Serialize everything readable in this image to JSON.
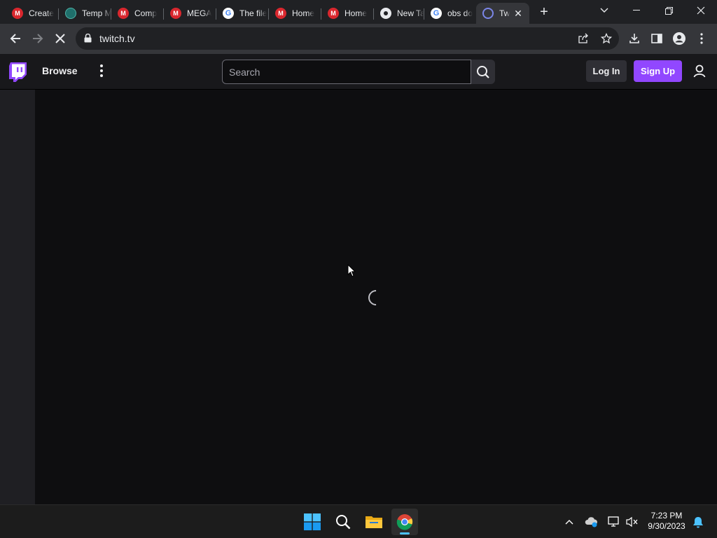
{
  "browser": {
    "tabs": [
      {
        "title": "Create",
        "favicon": "mega-icon"
      },
      {
        "title": "Temp M",
        "favicon": "temp-icon"
      },
      {
        "title": "Comp",
        "favicon": "mega-icon"
      },
      {
        "title": "MEGA",
        "favicon": "mega-icon"
      },
      {
        "title": "The file",
        "favicon": "google-icon"
      },
      {
        "title": "Home",
        "favicon": "mega-icon"
      },
      {
        "title": "Home",
        "favicon": "mega-icon"
      },
      {
        "title": "New Ta",
        "favicon": "chrome-icon"
      },
      {
        "title": "obs do",
        "favicon": "google-icon"
      },
      {
        "title": "Tw",
        "favicon": "loading-icon",
        "active": true
      }
    ],
    "url": "twitch.tv"
  },
  "twitch": {
    "browse_label": "Browse",
    "search_placeholder": "Search",
    "login_label": "Log In",
    "signup_label": "Sign Up",
    "brand_color": "#9147ff"
  },
  "taskbar": {
    "time": "7:23 PM",
    "date": "9/30/2023"
  }
}
